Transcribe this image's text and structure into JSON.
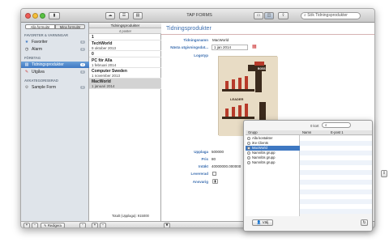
{
  "window": {
    "title": "TAP FORMS",
    "search_placeholder": "Sök Tidningsprodukter"
  },
  "sidebar": {
    "segments": [
      "Alla formulär",
      "Mina formulär"
    ],
    "sections": [
      {
        "title": "FAVORITER & VARNINGAR",
        "items": [
          {
            "label": "Favoriter",
            "count": "0",
            "icon": "star-icon"
          },
          {
            "label": "Alarm",
            "count": "0",
            "icon": "clock-icon"
          }
        ]
      },
      {
        "title": "FÖRETAG",
        "items": [
          {
            "label": "Tidningsprodukter",
            "count": "4",
            "icon": "form-icon",
            "selected": true
          },
          {
            "label": "Utgåva",
            "count": "0",
            "icon": "pencil-icon"
          }
        ]
      },
      {
        "title": "AVKATEGORISERAD",
        "items": [
          {
            "label": "Sample Form",
            "count": "0",
            "icon": "gear-icon"
          }
        ]
      }
    ],
    "edit_label": "Redigera"
  },
  "records": {
    "header": "Tidningsprodukter",
    "count_label": "4 poster",
    "rows": [
      {
        "title": "1",
        "date": ""
      },
      {
        "title": "TechWorld",
        "date": "9 oktober 2013"
      },
      {
        "title": "0",
        "date": ""
      },
      {
        "title": "PC för Alla",
        "date": "1 februari 2014"
      },
      {
        "title": "Computer Sweden",
        "date": "1 november 2013"
      },
      {
        "title": "MacWorld",
        "date": "1 januari 2014"
      }
    ],
    "footer": "Totalt (Upplaga): 915000"
  },
  "detail": {
    "header": "Tidningsprodukter",
    "fields": {
      "name_label": "Tidningsnamn",
      "name_value": "MacWorld",
      "next_label": "Nästa utgivningsdat...",
      "next_value": "1 jan 2014",
      "logo_label": "Logotyp",
      "circ_label": "Upplaga",
      "circ_value": "500000",
      "price_label": "Pris",
      "price_value": "80",
      "income_label": "Intäkt",
      "income_value": "40000000.000000",
      "delivered_label": "Levererad",
      "owner_label": "Ansvarig"
    },
    "logo_texts": {
      "boss": "BOSS",
      "leader": "LEADER"
    }
  },
  "popup": {
    "search_count": "0 kort",
    "col_group": "Grupp",
    "col_name": "Namn",
    "col_email": "E-post 1",
    "groups": [
      "Alla kontakter",
      "iKe Clients",
      "MacWorld",
      "Namnlös grupp",
      "Namnlös grupp",
      "Namnlös grupp"
    ],
    "selected_index": 2,
    "choose_label": "Välj"
  }
}
